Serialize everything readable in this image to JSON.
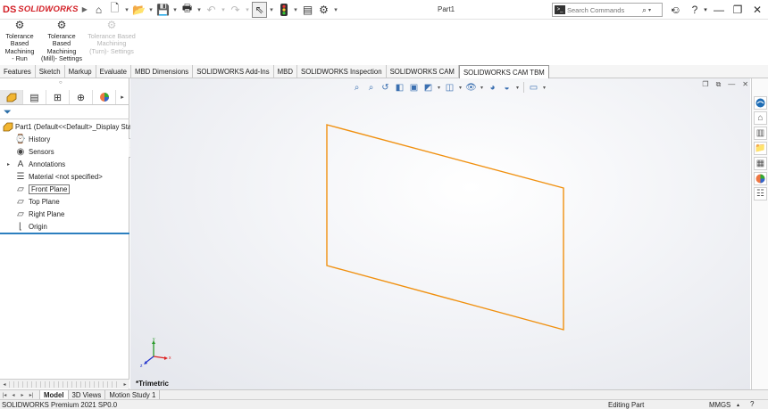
{
  "app": {
    "brand_mark": "DS",
    "brand_name": "SOLIDWORKS",
    "document_title": "Part1"
  },
  "search": {
    "placeholder": "Search Commands"
  },
  "command_manager": {
    "buttons": [
      {
        "label_lines": [
          "Tolerance",
          "Based",
          "Machining",
          "- Run"
        ],
        "enabled": true
      },
      {
        "label_lines": [
          "Tolerance",
          "Based",
          "Machining",
          "(Mill)- Settings"
        ],
        "enabled": true
      },
      {
        "label_lines": [
          "Tolerance Based",
          "Machining",
          "(Turn)- Settings"
        ],
        "enabled": false
      }
    ]
  },
  "tabs": [
    {
      "label": "Features"
    },
    {
      "label": "Sketch"
    },
    {
      "label": "Markup"
    },
    {
      "label": "Evaluate"
    },
    {
      "label": "MBD Dimensions"
    },
    {
      "label": "SOLIDWORKS Add-Ins"
    },
    {
      "label": "MBD"
    },
    {
      "label": "SOLIDWORKS Inspection"
    },
    {
      "label": "SOLIDWORKS CAM"
    },
    {
      "label": "SOLIDWORKS CAM TBM",
      "active": true
    }
  ],
  "feature_tree": {
    "root": "Part1  (Default<<Default>_Display Sta",
    "items": [
      {
        "label": "History",
        "icon": "history-icon",
        "expandable": false
      },
      {
        "label": "Sensors",
        "icon": "sensors-icon",
        "expandable": false
      },
      {
        "label": "Annotations",
        "icon": "annotations-icon",
        "expandable": true
      },
      {
        "label": "Material <not specified>",
        "icon": "material-icon",
        "expandable": false
      },
      {
        "label": "Front Plane",
        "icon": "plane-icon",
        "expandable": false,
        "selected": true
      },
      {
        "label": "Top Plane",
        "icon": "plane-icon",
        "expandable": false
      },
      {
        "label": "Right Plane",
        "icon": "plane-icon",
        "expandable": false
      },
      {
        "label": "Origin",
        "icon": "origin-icon",
        "expandable": false
      }
    ]
  },
  "viewport": {
    "view_orientation": "*Trimetric",
    "plane_color": "#f0900f"
  },
  "model_tabs": [
    {
      "label": "Model",
      "active": true
    },
    {
      "label": "3D Views"
    },
    {
      "label": "Motion Study 1"
    }
  ],
  "status": {
    "product": "SOLIDWORKS Premium 2021 SP0.0",
    "mode": "Editing Part",
    "units": "MMGS"
  },
  "colors": {
    "brand_red": "#d32027",
    "selection_blue": "#2c7fbf"
  }
}
